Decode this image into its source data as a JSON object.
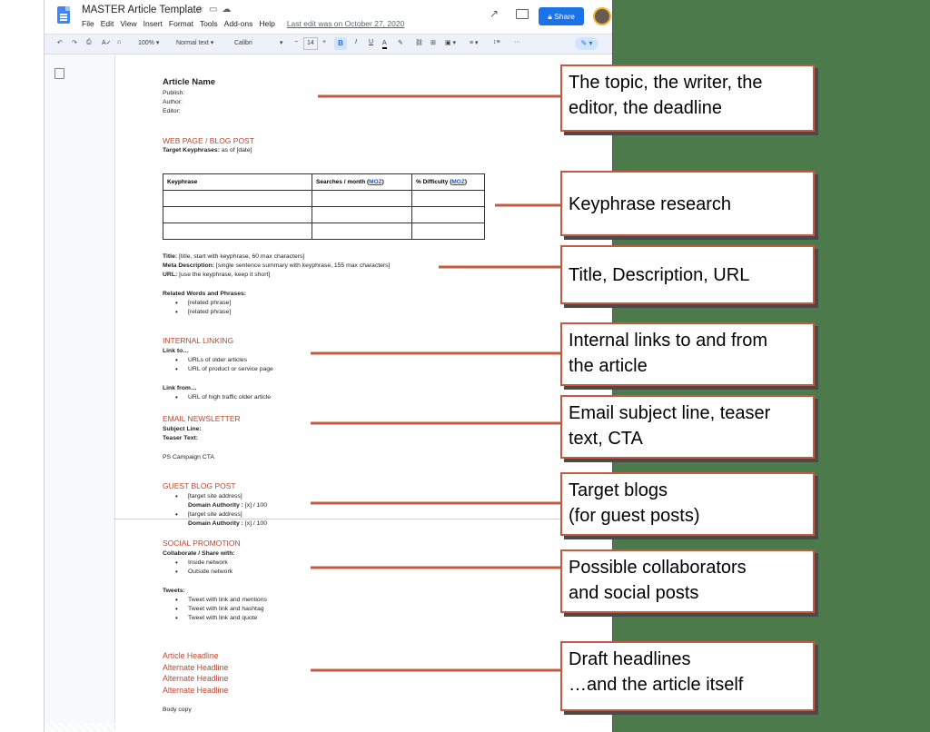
{
  "doc_title": "MASTER Article Template",
  "menu": [
    "File",
    "Edit",
    "View",
    "Insert",
    "Format",
    "Tools",
    "Add-ons",
    "Help"
  ],
  "last_edit": "Last edit was on October 27, 2020",
  "share_label": "Share",
  "toolbar": {
    "zoom": "100%",
    "style": "Normal text",
    "font": "Calibri",
    "size": "14",
    "bold": "B",
    "italic": "I",
    "underline": "U",
    "color": "A"
  },
  "doc": {
    "article_name": "Article Name",
    "publish": "Publish:",
    "author": "Author:",
    "editor": "Editor:",
    "web_heading": "WEB PAGE / BLOG POST",
    "target_kp_label": "Target Keyphrases:",
    "target_kp_text": " as of [date]",
    "table_headers": {
      "c1": "Keyphrase",
      "c2": "Searches / month (",
      "c3": "% Difficulty (",
      "moz": "MOZ",
      "close": ")"
    },
    "title_label": "Title:",
    "title_text": " [title, start with keyphrase, 60 max characters]",
    "meta_label": "Meta Description:",
    "meta_text": " [single sentence summary with keyphrase, 155 max characters]",
    "url_label": "URL:",
    "url_text": " [use the keyphrase, keep it short]",
    "related_label": "Related Words and Phrases:",
    "related_items": [
      "[related phrase]",
      "[related phrase]"
    ],
    "internal_heading": "INTERNAL LINKING",
    "link_to": "Link to…",
    "link_to_items": [
      "URLs of older articles",
      "URL of product or service page"
    ],
    "link_from": "Link from…",
    "link_from_items": [
      "URL of high traffic older article"
    ],
    "email_heading": "EMAIL NEWSLETTER",
    "subject_line": "Subject Line:",
    "teaser_text": "Teaser Text:",
    "ps_cta": "PS Campaign CTA",
    "guest_heading": "GUEST BLOG POST",
    "guest_site": "[target site address]",
    "domain_authority_label": "Domain Authority :",
    "domain_authority_text": " [x] / 100",
    "social_heading": "SOCIAL PROMOTION",
    "collab_label": "Collaborate / Share with:",
    "collab_items": [
      "Inside network",
      "Outside network"
    ],
    "tweets_label": "Tweets:",
    "tweet_items": [
      "Tweet with link and mentions",
      "Tweet with link and hashtag",
      "Tweet with link and quote"
    ],
    "headlines": [
      "Article Headline",
      "Alternate Headline",
      "Alternate Headline",
      "Alternate Headline"
    ],
    "body_copy": "Body copy"
  },
  "callouts": [
    {
      "l1": "The topic, the writer, the",
      "l2": "editor, the deadline"
    },
    {
      "l1": "Keyphrase research",
      "l2": ""
    },
    {
      "l1": "Title, Description, URL",
      "l2": ""
    },
    {
      "l1": "Internal links to and from",
      "l2": "the article"
    },
    {
      "l1": "Email subject line, teaser",
      "l2": "text, CTA"
    },
    {
      "l1": "Target blogs",
      "l2": "(for guest posts)"
    },
    {
      "l1": "Possible collaborators",
      "l2": "and social posts"
    },
    {
      "l1": "Draft headlines",
      "l2": "…and the article itself"
    }
  ],
  "colors": {
    "accent_red": "#c0442c",
    "arrow": "#c25b40",
    "share_blue": "#1a73e8",
    "background_green": "#4d7a4b"
  }
}
